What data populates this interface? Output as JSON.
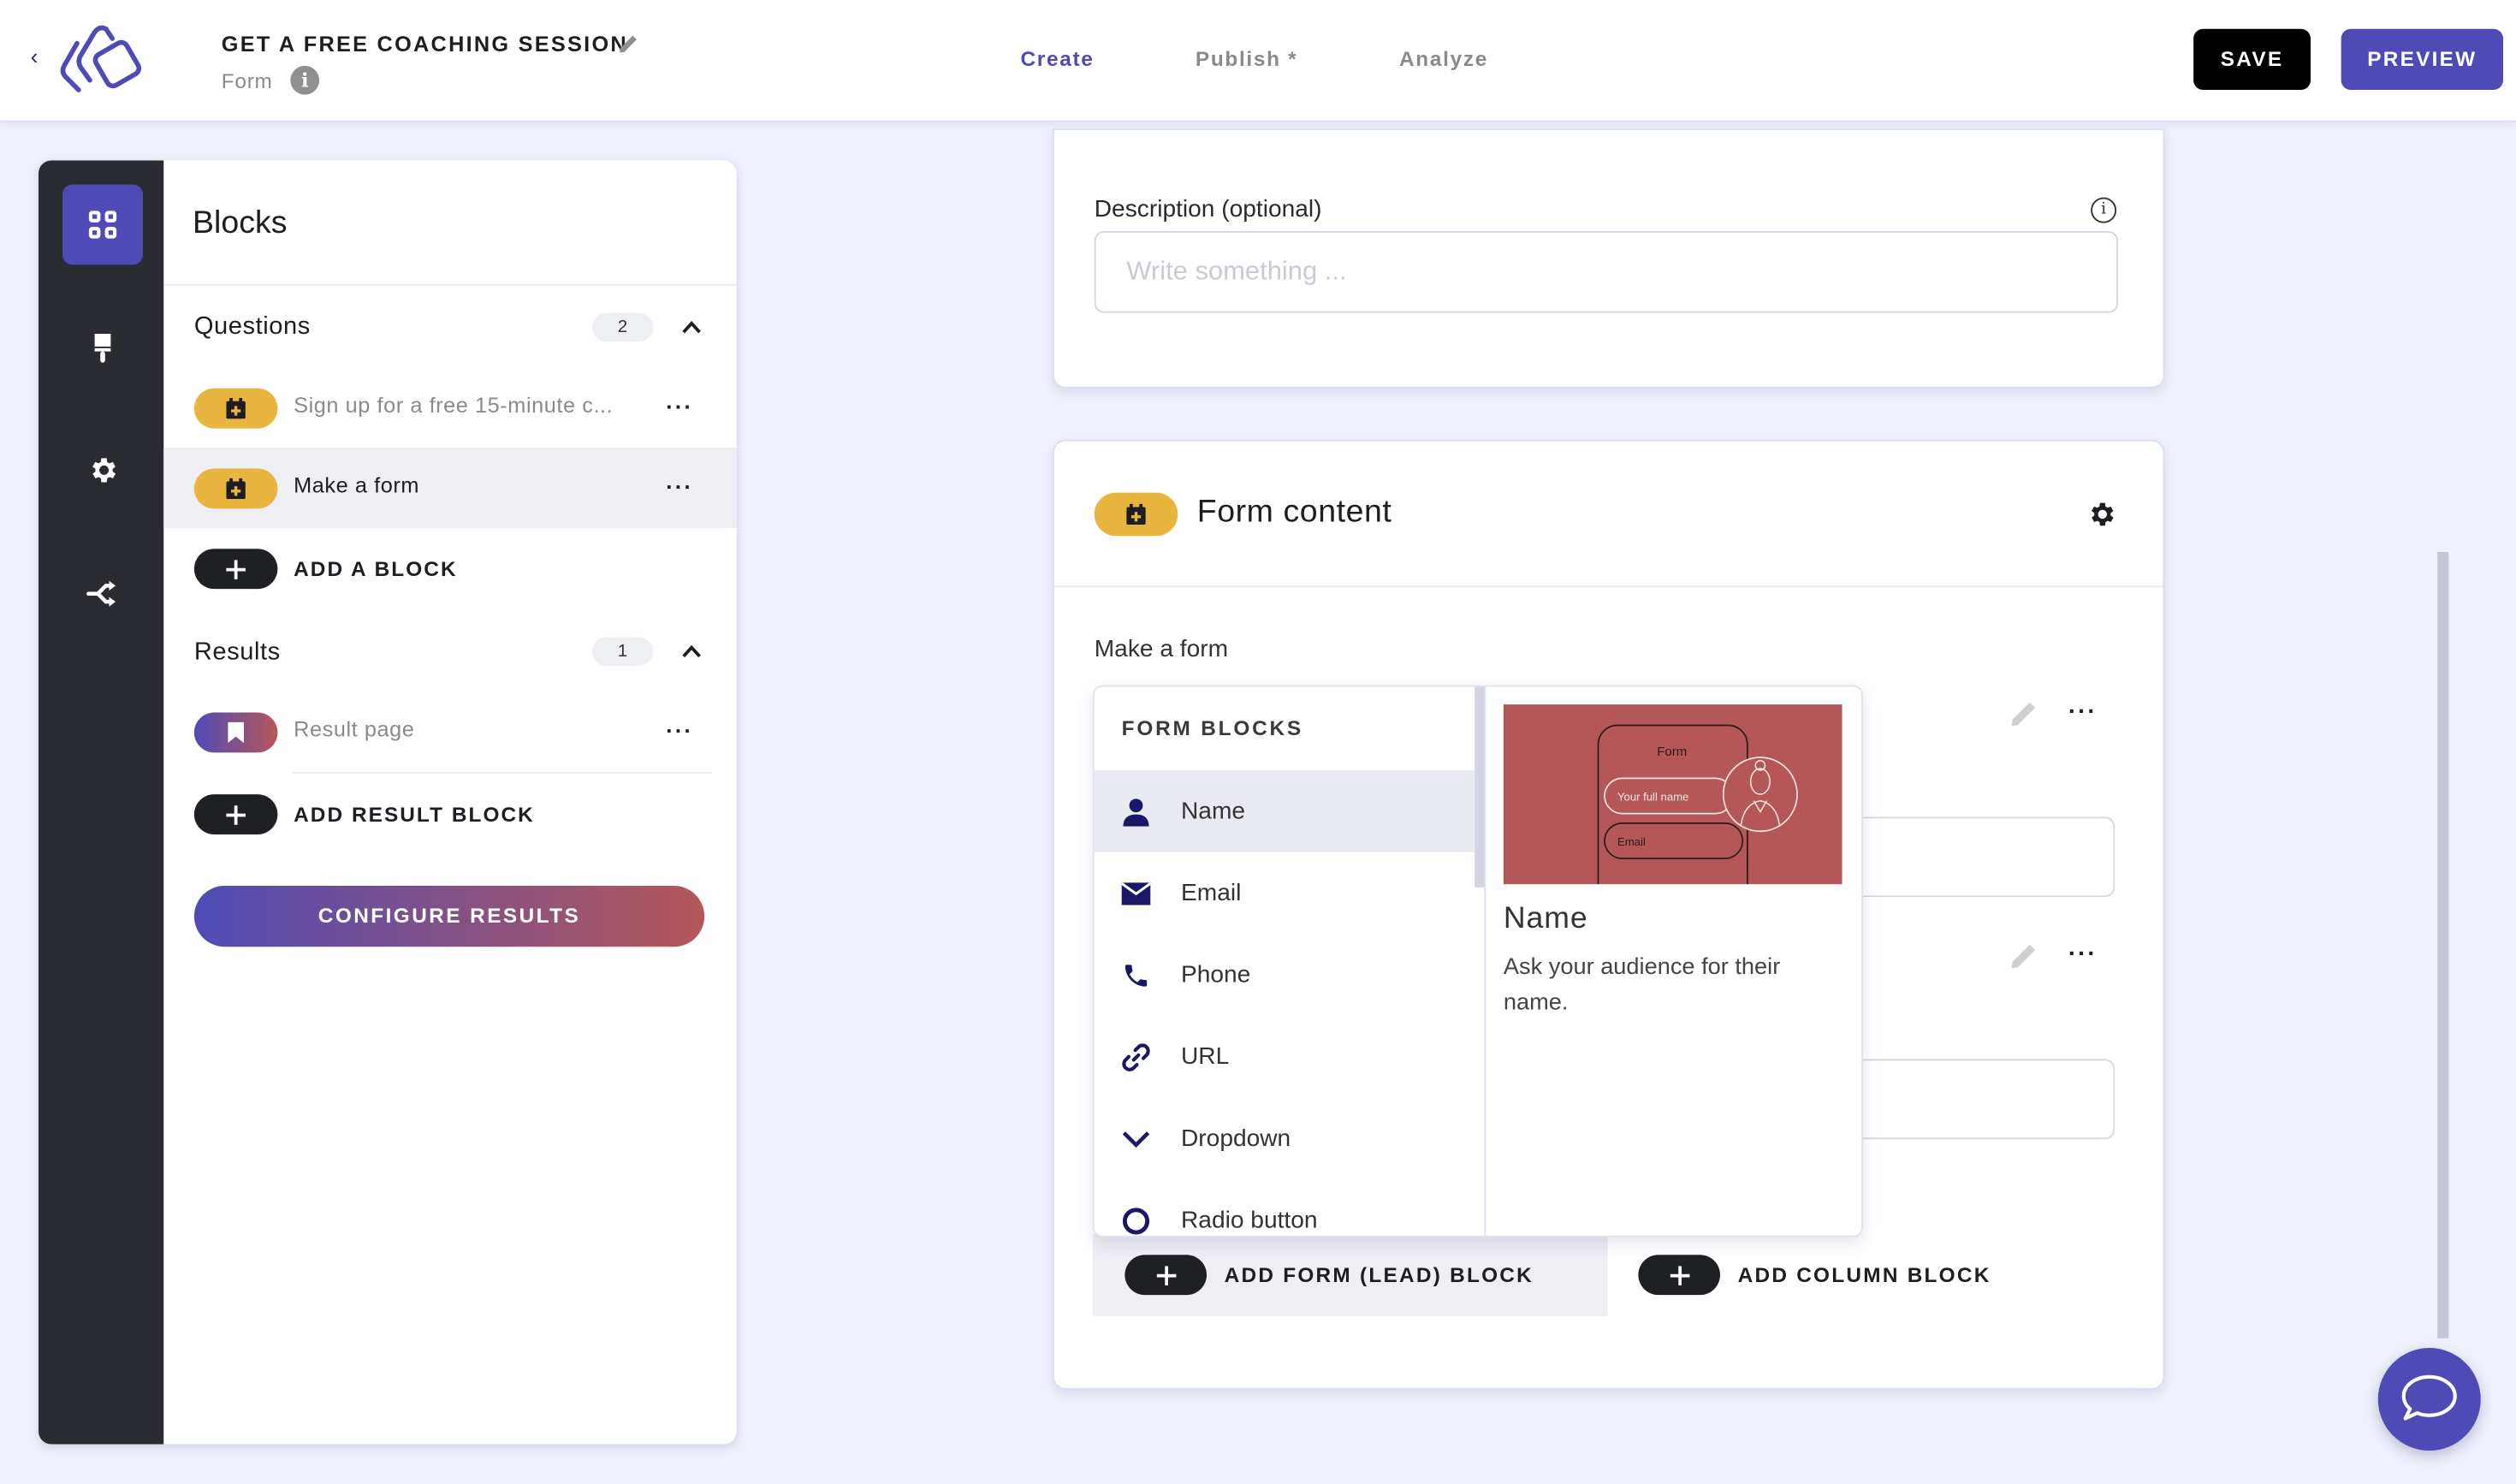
{
  "header": {
    "back_label": "‹",
    "title": "GET A FREE COACHING SESSION",
    "subtitle": "Form",
    "info_icon": "i",
    "tabs": [
      {
        "label": "Create",
        "active": true
      },
      {
        "label": "Publish *",
        "active": false
      },
      {
        "label": "Analyze",
        "active": false
      }
    ],
    "save_label": "SAVE",
    "preview_label": "PREVIEW"
  },
  "rail": {
    "items": [
      {
        "icon": "blocks-grid-icon",
        "active": true
      },
      {
        "icon": "paint-brush-icon",
        "active": false
      },
      {
        "icon": "gear-icon",
        "active": false
      },
      {
        "icon": "branch-logic-icon",
        "active": false
      }
    ]
  },
  "sidebar": {
    "title": "Blocks",
    "questions": {
      "label": "Questions",
      "count": "2",
      "items": [
        {
          "label": "Sign up for a free 15-minute c...",
          "icon": "form-block-icon",
          "selected": false
        },
        {
          "label": "Make a form",
          "icon": "form-block-icon",
          "selected": true
        }
      ],
      "add_label": "ADD A BLOCK"
    },
    "results": {
      "label": "Results",
      "count": "1",
      "items": [
        {
          "label": "Result page",
          "icon": "bookmark-icon"
        }
      ],
      "add_label": "ADD RESULT BLOCK"
    },
    "configure_label": "CONFIGURE RESULTS",
    "more_label": "···"
  },
  "main": {
    "description": {
      "label": "Description (optional)",
      "placeholder": "Write something ...",
      "info_icon": "i"
    },
    "form_content": {
      "title": "Form content",
      "block_label": "Make a form",
      "more_label": "···"
    },
    "form_blocks": {
      "heading": "FORM BLOCKS",
      "items": [
        {
          "label": "Name",
          "icon": "person-icon",
          "selected": true
        },
        {
          "label": "Email",
          "icon": "envelope-icon",
          "selected": false
        },
        {
          "label": "Phone",
          "icon": "phone-icon",
          "selected": false
        },
        {
          "label": "URL",
          "icon": "link-icon",
          "selected": false
        },
        {
          "label": "Dropdown",
          "icon": "chevron-down-icon",
          "selected": false
        },
        {
          "label": "Radio button",
          "icon": "radio-icon",
          "selected": false
        }
      ],
      "preview": {
        "image_form_label": "Form",
        "image_name_field": "Your full name",
        "image_email_field": "Email",
        "title": "Name",
        "description": "Ask your audience for their name."
      }
    },
    "add_form_block_label": "ADD FORM (LEAD) BLOCK",
    "add_column_block_label": "ADD COLUMN BLOCK"
  },
  "colors": {
    "brand": "#4f4bb6",
    "question_pill": "#e8b63e",
    "result_gradient_end": "#b55758",
    "rail_bg": "#2a2c31",
    "page_bg": "#eef0fb"
  }
}
